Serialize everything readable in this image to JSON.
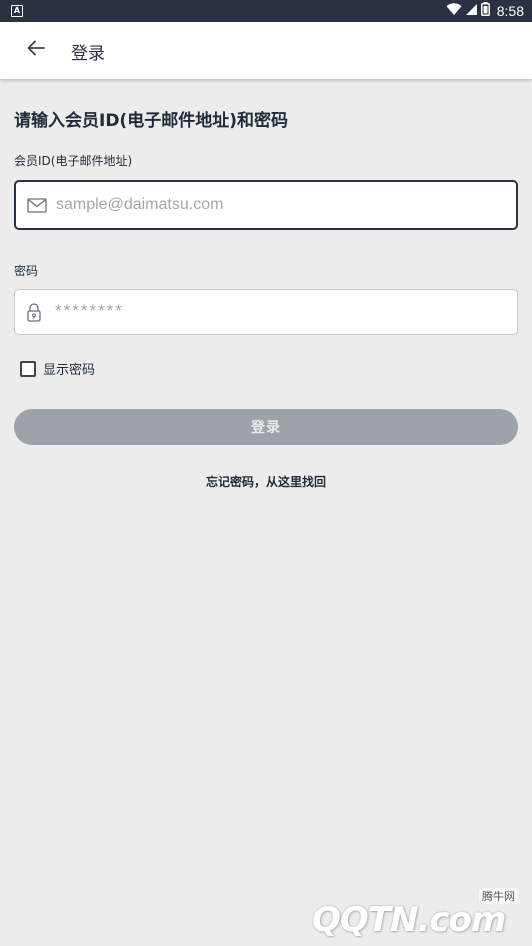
{
  "status_bar": {
    "app_icon_label": "A",
    "time": "8:58",
    "icons": [
      "wifi-icon",
      "signal-icon",
      "battery-icon"
    ]
  },
  "app_bar": {
    "title": "登录",
    "back_icon": "arrow-left-icon"
  },
  "form": {
    "heading": "请输入会员ID(电子邮件地址)和密码",
    "email": {
      "label": "会员ID(电子邮件地址)",
      "placeholder": "sample@daimatsu.com",
      "value": "",
      "icon": "mail-icon"
    },
    "password": {
      "label": "密码",
      "placeholder": "********",
      "value": "",
      "icon": "lock-icon"
    },
    "show_password": {
      "label": "显示密码",
      "checked": false
    },
    "login_button_label": "登录",
    "forgot_link": "忘记密码，从这里找回"
  },
  "watermark": {
    "logo_text": "QQTN.com",
    "tag": "腾牛网"
  },
  "colors": {
    "status_bar": "#2a3242",
    "background": "#ececec",
    "button_disabled": "#9ea3aa",
    "text_primary": "#1f2b3a",
    "input_focus_border": "#2a3242"
  }
}
